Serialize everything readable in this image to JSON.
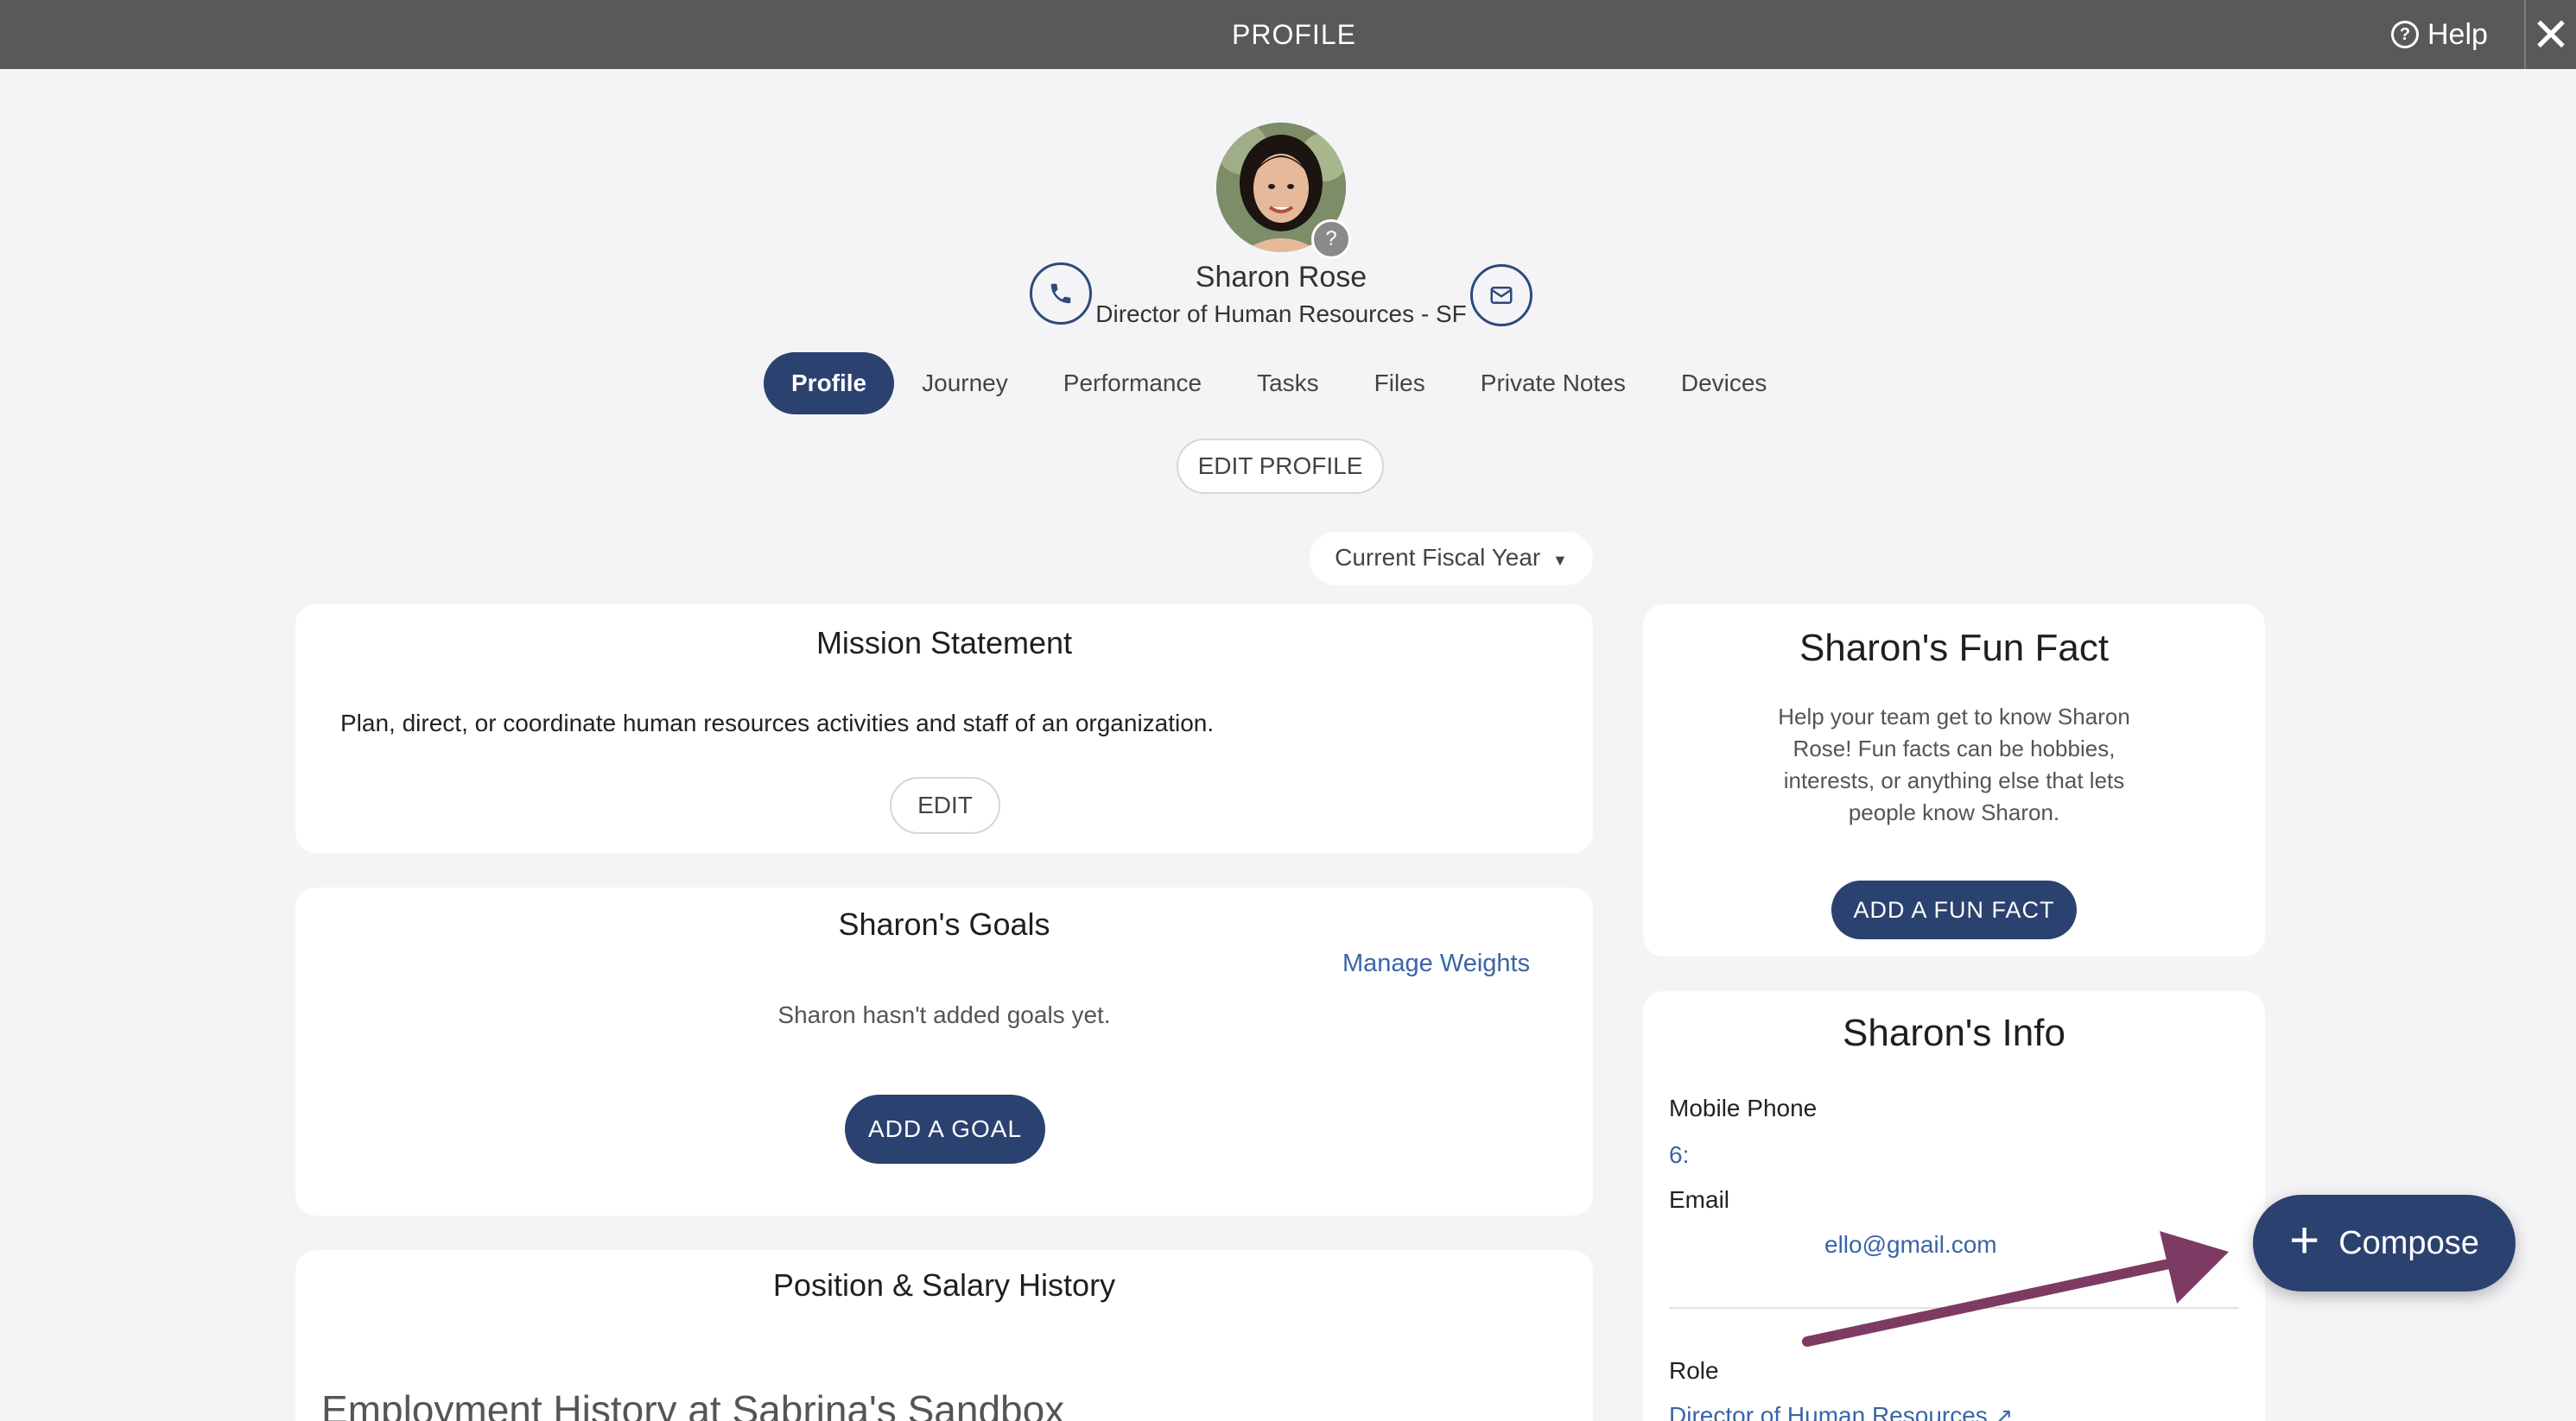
{
  "topbar": {
    "title": "PROFILE",
    "help_label": "Help",
    "help_icon": "question-circle-icon",
    "close_icon": "close-icon"
  },
  "profile": {
    "name": "Sharon Rose",
    "role": "Director of Human Resources - SF",
    "avatar_badge": "?",
    "phone_icon": "phone-icon",
    "email_icon": "envelope-icon"
  },
  "tabs": [
    {
      "label": "Profile",
      "active": true
    },
    {
      "label": "Journey"
    },
    {
      "label": "Performance"
    },
    {
      "label": "Tasks"
    },
    {
      "label": "Files"
    },
    {
      "label": "Private Notes"
    },
    {
      "label": "Devices"
    }
  ],
  "edit_profile_label": "EDIT PROFILE",
  "fiscal_select": {
    "value": "Current Fiscal Year"
  },
  "mission": {
    "title": "Mission Statement",
    "text": "Plan, direct, or coordinate human resources activities and staff of an organization.",
    "edit_label": "EDIT"
  },
  "goals": {
    "title": "Sharon's Goals",
    "manage_label": "Manage Weights",
    "empty_text": "Sharon hasn't added goals yet.",
    "add_label": "ADD A GOAL"
  },
  "position": {
    "title": "Position & Salary History",
    "subtitle": "Employment History at Sabrina's Sandbox"
  },
  "fun_fact": {
    "title": "Sharon's Fun Fact",
    "text": "Help your team get to know Sharon Rose! Fun facts can be hobbies, interests, or anything else that lets people know Sharon.",
    "add_label": "ADD A FUN FACT"
  },
  "info": {
    "title": "Sharon's Info",
    "mobile_label": "Mobile Phone",
    "mobile_value": "6:",
    "email_label": "Email",
    "email_value": "ello@gmail.com",
    "role_label": "Role",
    "role_value": "Director of Human Resources"
  },
  "compose": {
    "label": "Compose"
  },
  "colors": {
    "topbar": "#58595b",
    "primary": "#2b4170",
    "link": "#3a64a8",
    "arrow": "#7d3a63",
    "background": "#f4f4f6"
  }
}
